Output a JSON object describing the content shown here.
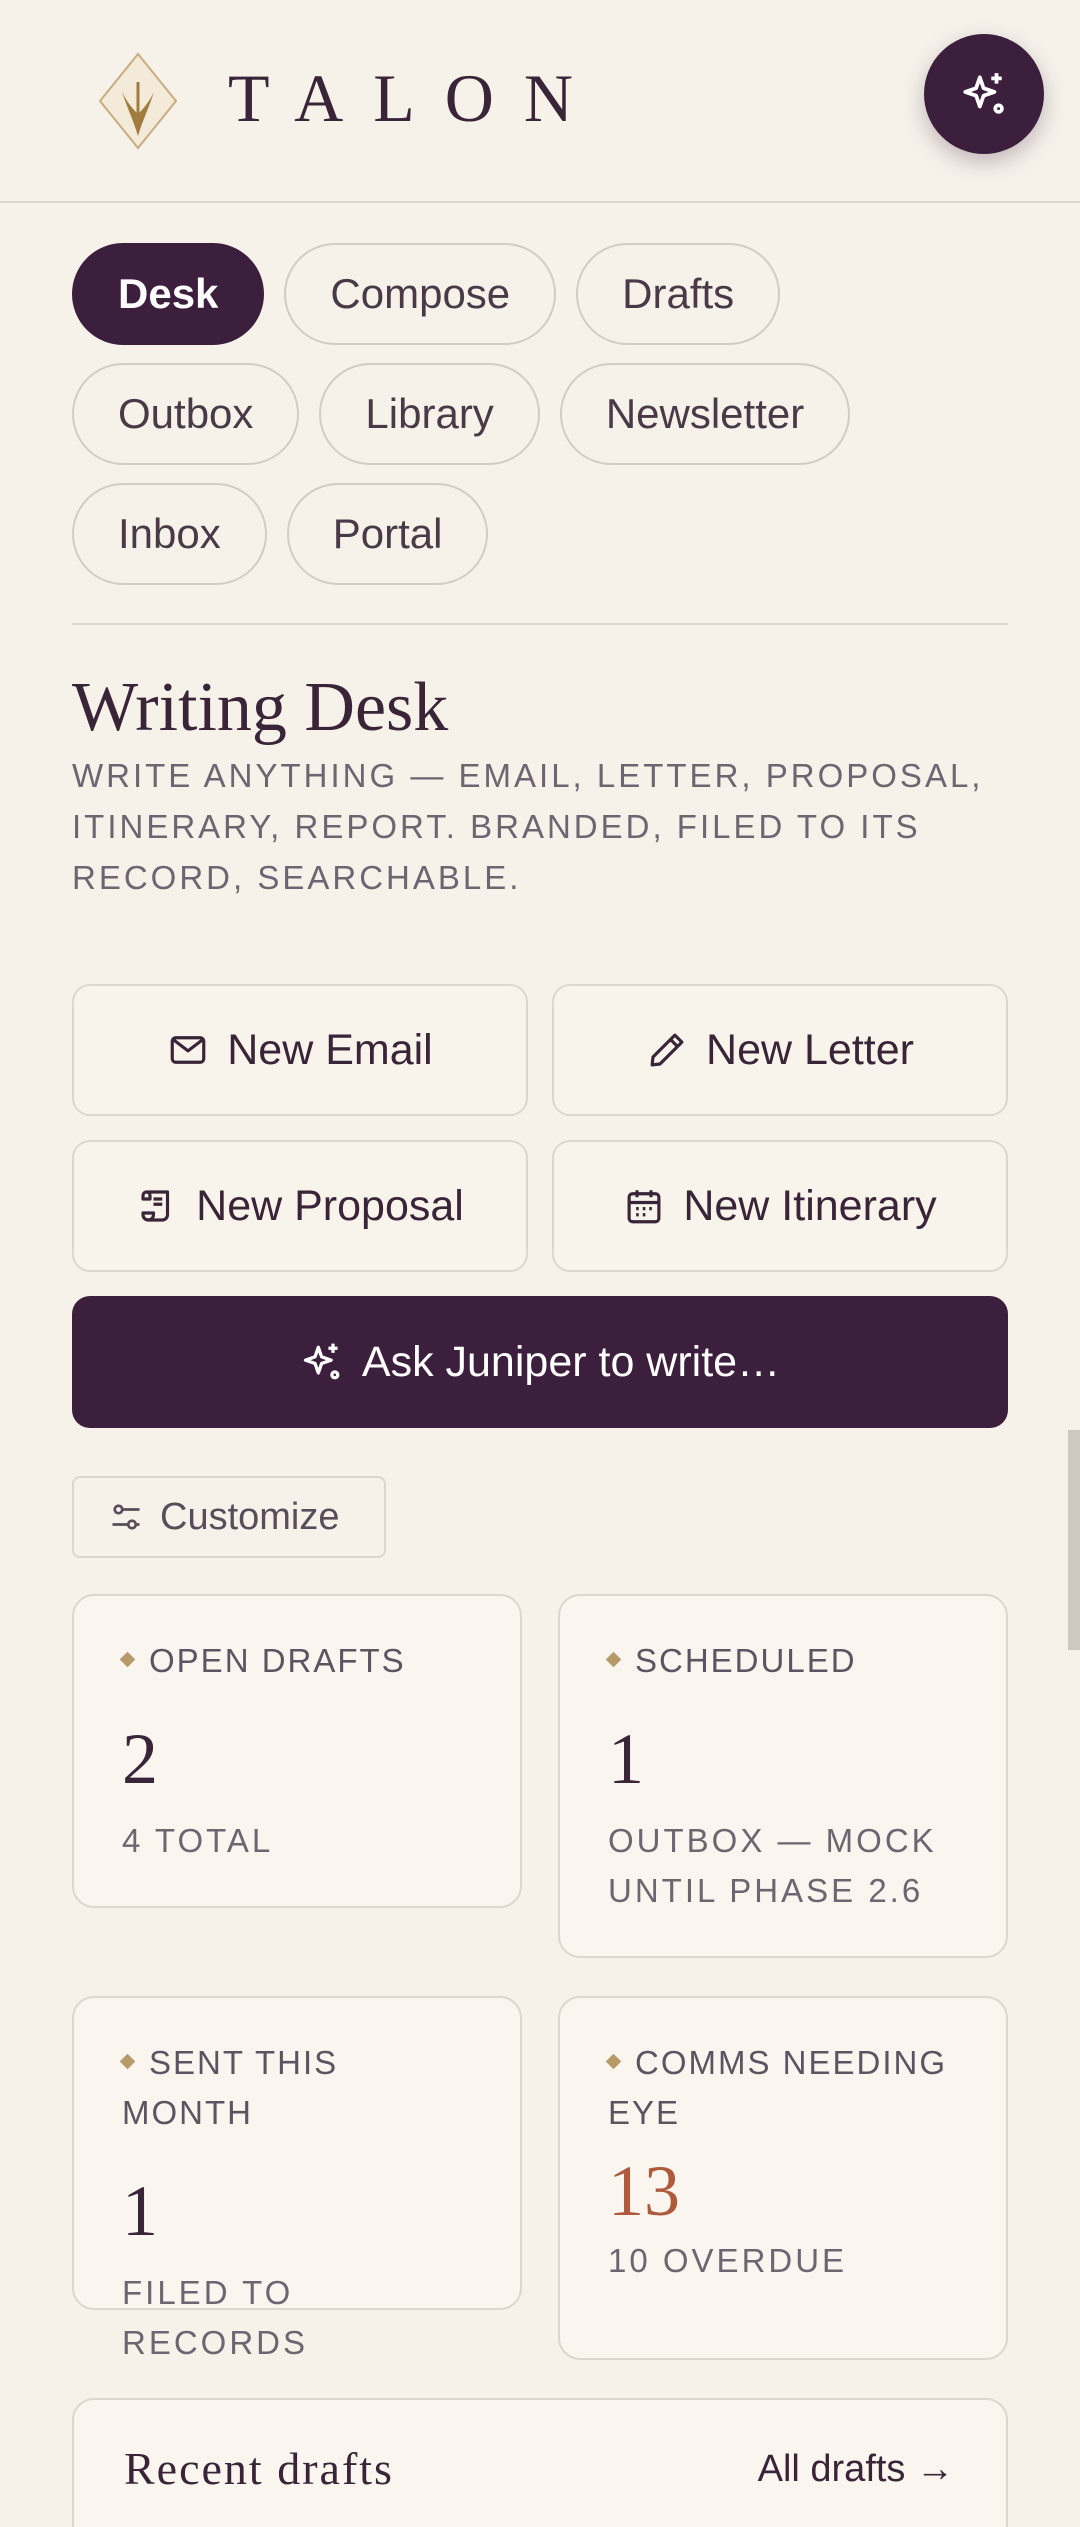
{
  "app": {
    "brand": "TALON",
    "assistant_button_label": "Juniper"
  },
  "tabs": [
    {
      "label": "Desk",
      "active": true
    },
    {
      "label": "Compose",
      "active": false
    },
    {
      "label": "Drafts",
      "active": false
    },
    {
      "label": "Outbox",
      "active": false
    },
    {
      "label": "Library",
      "active": false
    },
    {
      "label": "Newsletter",
      "active": false
    },
    {
      "label": "Inbox",
      "active": false
    },
    {
      "label": "Portal",
      "active": false
    }
  ],
  "page": {
    "title": "Writing Desk",
    "subtitle": "WRITE ANYTHING — EMAIL, LETTER, PROPOSAL, ITINERARY, REPORT. BRANDED, FILED TO ITS RECORD, SEARCHABLE."
  },
  "actions": {
    "new_email": {
      "label": "New Email",
      "icon": "mail-icon"
    },
    "new_letter": {
      "label": "New Letter",
      "icon": "pen-icon"
    },
    "new_proposal": {
      "label": "New Proposal",
      "icon": "scroll-icon"
    },
    "new_itinerary": {
      "label": "New Itinerary",
      "icon": "calendar-icon"
    },
    "ask": {
      "label": "Ask Juniper to write…",
      "icon": "sparkle-icon"
    },
    "customize": {
      "label": "Customize",
      "icon": "sliders-icon"
    }
  },
  "stats": {
    "open_drafts": {
      "label": "OPEN DRAFTS",
      "value": "2",
      "sub": "4 TOTAL"
    },
    "scheduled": {
      "label": "SCHEDULED",
      "value": "1",
      "sub": "OUTBOX — MOCK UNTIL PHASE 2.6"
    },
    "sent_this_month": {
      "label": "SENT THIS MONTH",
      "value": "1",
      "sub": "FILED TO RECORDS"
    },
    "comms_needing_eye": {
      "label": "COMMS NEEDING EYE",
      "value": "13",
      "sub": "10 OVERDUE"
    }
  },
  "recent": {
    "title": "Recent drafts",
    "link": "All drafts →"
  },
  "colors": {
    "background": "#f6f2ea",
    "primary": "#3b1f3c",
    "accent_gold": "#b89a6a",
    "alert": "#b05a3c"
  }
}
